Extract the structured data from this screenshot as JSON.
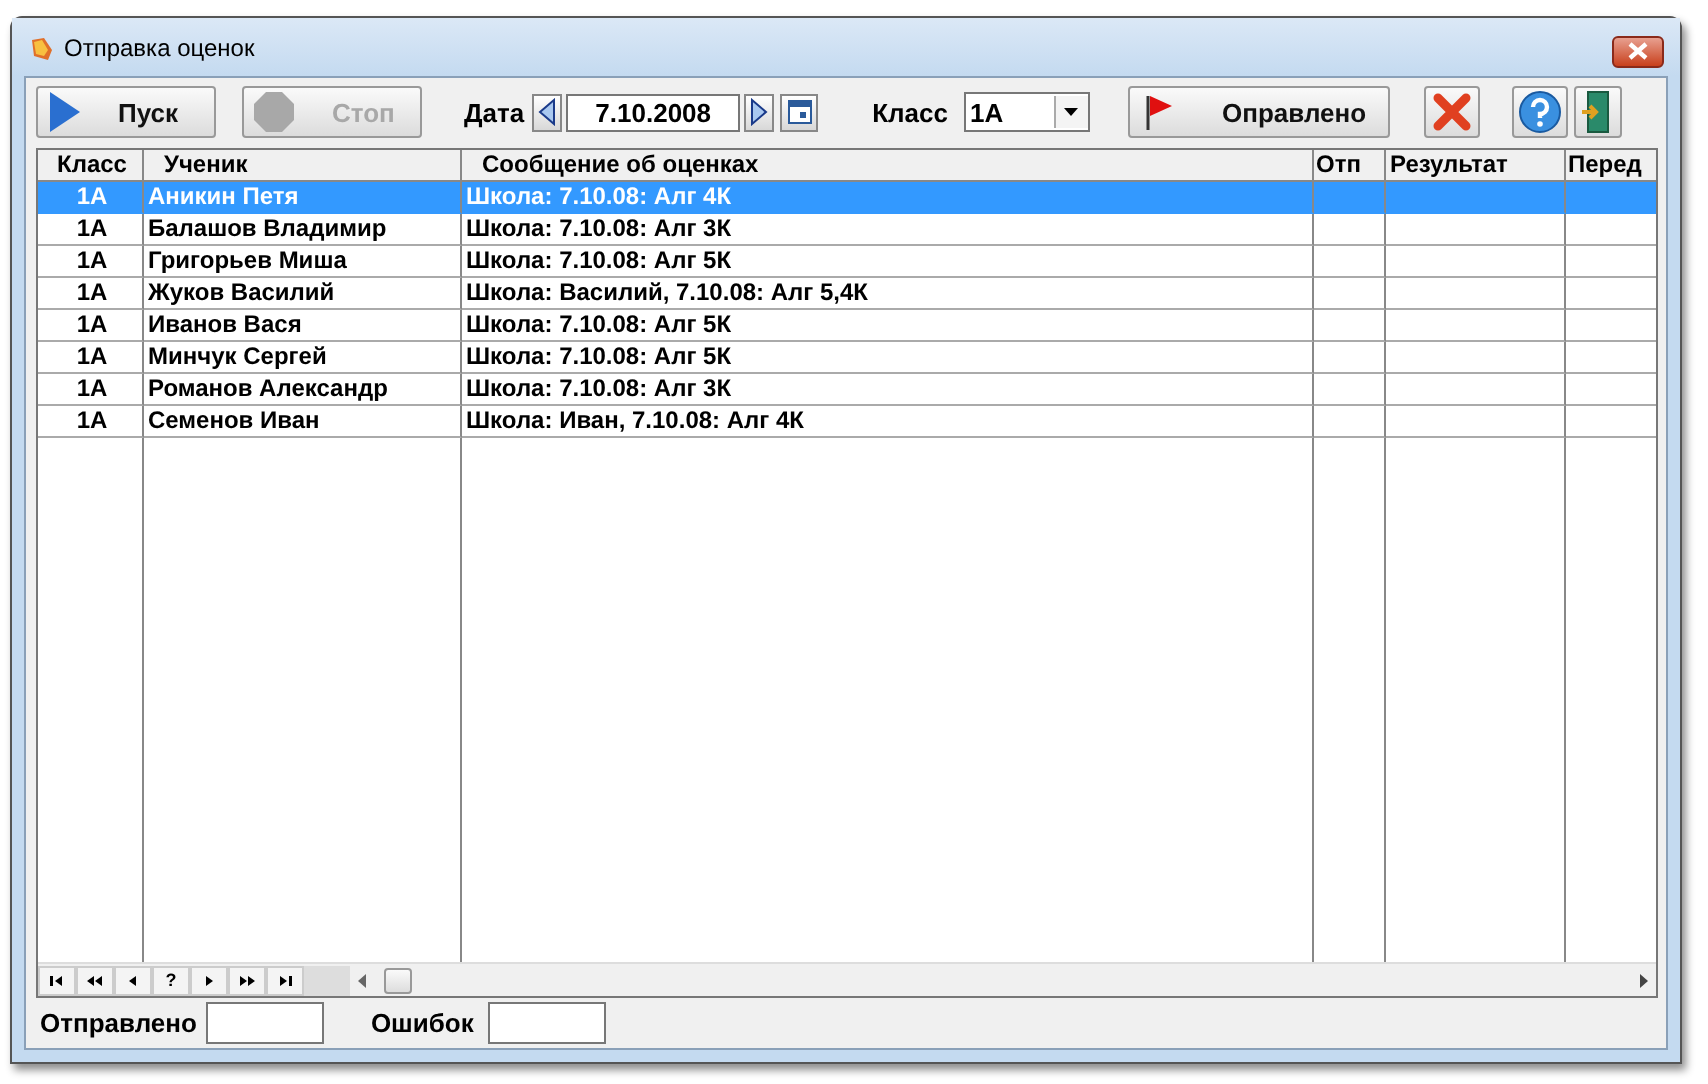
{
  "window": {
    "title": "Отправка оценок"
  },
  "toolbar": {
    "start": {
      "label": "Пуск",
      "disabled": false
    },
    "stop": {
      "label": "Стоп",
      "disabled": true
    },
    "date_label": "Дата",
    "date": "7.10.2008",
    "class_label": "Класс",
    "class_value": "1А",
    "sent_button": "Оправлено"
  },
  "table": {
    "columns": [
      "Класс",
      "Ученик",
      "Сообщение об оценках",
      "Отп",
      "Результат",
      "Перед"
    ],
    "rows": [
      {
        "class": "1А",
        "student": "Аникин Петя",
        "message": "Школа:  7.10.08: Алг 4К",
        "selected": true
      },
      {
        "class": "1А",
        "student": "Балашов Владимир",
        "message": "Школа:  7.10.08: Алг 3К",
        "selected": false
      },
      {
        "class": "1А",
        "student": "Григорьев Миша",
        "message": "Школа:  7.10.08: Алг 5К",
        "selected": false
      },
      {
        "class": "1А",
        "student": "Жуков Василий",
        "message": "Школа: Василий,  7.10.08: Алг 5,4К",
        "selected": false
      },
      {
        "class": "1А",
        "student": "Иванов Вася",
        "message": "Школа:  7.10.08: Алг 5К",
        "selected": false
      },
      {
        "class": "1А",
        "student": "Минчук Сергей",
        "message": "Школа:  7.10.08: Алг 5К",
        "selected": false
      },
      {
        "class": "1А",
        "student": "Романов Александр",
        "message": "Школа:  7.10.08: Алг 3К",
        "selected": false
      },
      {
        "class": "1А",
        "student": "Семенов Иван",
        "message": "Школа: Иван,  7.10.08: Алг 4К",
        "selected": false
      }
    ]
  },
  "navigator": [
    {
      "kind": "first"
    },
    {
      "kind": "prev_page"
    },
    {
      "kind": "prev"
    },
    {
      "kind": "text",
      "label": "?"
    },
    {
      "kind": "next"
    },
    {
      "kind": "next_page"
    },
    {
      "kind": "last"
    }
  ],
  "footer": {
    "sent_label": "Отправлено",
    "errors_label": "Ошибок"
  }
}
